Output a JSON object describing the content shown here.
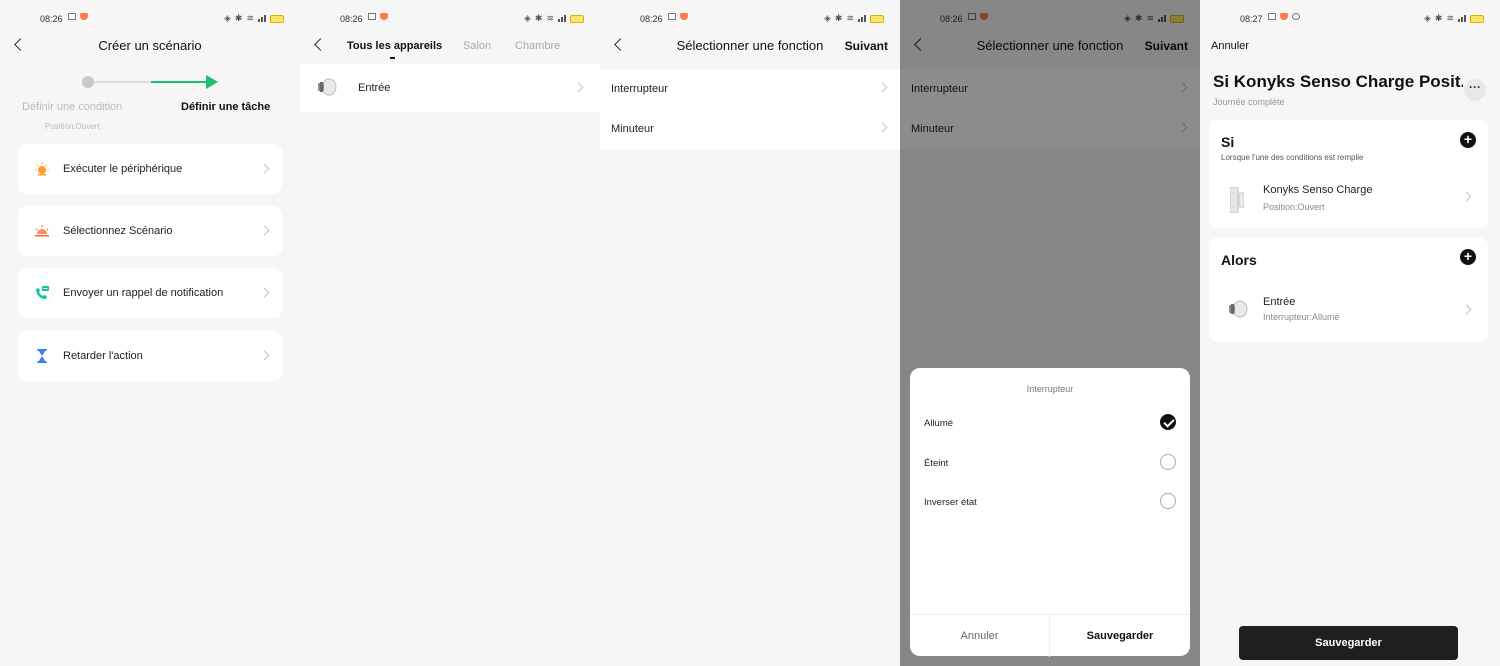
{
  "colors": {
    "accent_green": "#1dbf73",
    "brand_orange": "#ff9d2e",
    "dark_button": "#1f1f1f",
    "overlay": "rgba(0,0,0,0.45)"
  },
  "s1": {
    "time": "08:26",
    "title": "Créer un scénario",
    "step1_label": "Définir une condition",
    "step1_sub": "Position:Ouvert",
    "step2_label": "Définir une tâche",
    "items": [
      {
        "label": "Exécuter le périphérique",
        "icon": "sun-icon"
      },
      {
        "label": "Sélectionnez Scénario",
        "icon": "sunset-icon"
      },
      {
        "label": "Envoyer un rappel de notification",
        "icon": "phone-message-icon"
      },
      {
        "label": "Retarder l'action",
        "icon": "hourglass-icon"
      }
    ]
  },
  "s2": {
    "time": "08:26",
    "tabs": [
      "Tous les appareils",
      "Salon",
      "Chambre"
    ],
    "device": "Entrée"
  },
  "s3": {
    "time": "08:26",
    "title": "Sélectionner une fonction",
    "next": "Suivant",
    "functions": [
      "Interrupteur",
      "Minuteur"
    ]
  },
  "s4": {
    "time": "08:26",
    "title": "Sélectionner une fonction",
    "next": "Suivant",
    "functions": [
      "Interrupteur",
      "Minuteur"
    ],
    "sheet_title": "Interrupteur",
    "options": [
      "Allumé",
      "Éteint",
      "Inverser état"
    ],
    "cancel": "Annuler",
    "save": "Sauvegarder"
  },
  "s5": {
    "time": "08:27",
    "cancel": "Annuler",
    "title": "Si Konyks Senso Charge Posit...",
    "subtitle": "Journée complète",
    "if_header": "Si",
    "if_sub": "Lorsque l'une des conditions est remplie",
    "if_item_name": "Konyks Senso Charge",
    "if_item_sub": "Position:Ouvert",
    "then_header": "Alors",
    "then_item_name": "Entrée",
    "then_item_sub": "Interrupteur:Allumé",
    "save": "Sauvegarder"
  }
}
